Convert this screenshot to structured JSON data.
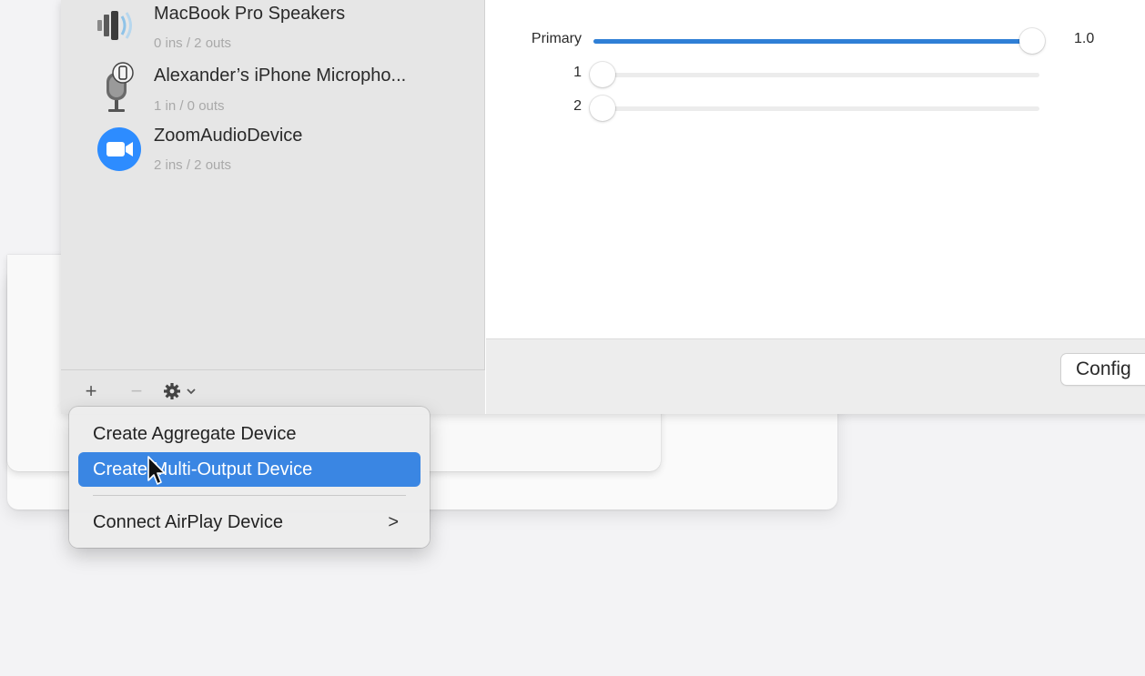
{
  "devices": [
    {
      "name": "MacBook Pro Speakers",
      "io": "0 ins / 2 outs",
      "icon": "speaker-icon"
    },
    {
      "name": "Alexander’s iPhone Micropho...",
      "io": "1 in / 0 outs",
      "icon": "iphone-microphone-icon"
    },
    {
      "name": "ZoomAudioDevice",
      "io": "2 ins / 2 outs",
      "icon": "zoom-icon"
    }
  ],
  "toolbar": {
    "add_glyph": "+",
    "remove_glyph": "−",
    "gear_icon": "gear-icon",
    "chevron_glyph": "⌄"
  },
  "volume": {
    "rows": [
      {
        "label": "Primary",
        "value": "1.0",
        "level": 1.0
      },
      {
        "label": "1",
        "value": "",
        "level": 0.0
      },
      {
        "label": "2",
        "value": "",
        "level": 0.0
      }
    ]
  },
  "footer": {
    "configure_label": "Config"
  },
  "menu": {
    "items": [
      {
        "label": "Create Aggregate Device"
      },
      {
        "label": "Create Multi-Output Device"
      },
      {
        "label": "Connect AirPlay Device"
      }
    ],
    "submenu_glyph": ">"
  },
  "colors": {
    "accent": "#3a86e3",
    "slider_fill": "#2f7fd6",
    "zoom_blue": "#2d8cff"
  }
}
